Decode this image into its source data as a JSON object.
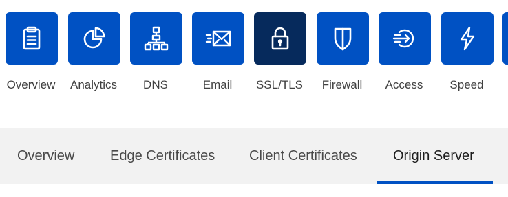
{
  "app_nav": {
    "tiles": [
      {
        "label": "Overview",
        "icon": "clipboard-icon"
      },
      {
        "label": "Analytics",
        "icon": "pie-chart-icon"
      },
      {
        "label": "DNS",
        "icon": "network-tree-icon"
      },
      {
        "label": "Email",
        "icon": "envelope-icon"
      },
      {
        "label": "SSL/TLS",
        "icon": "lock-icon",
        "active": true
      },
      {
        "label": "Firewall",
        "icon": "shield-icon"
      },
      {
        "label": "Access",
        "icon": "access-arrow-icon"
      },
      {
        "label": "Speed",
        "icon": "lightning-icon"
      }
    ]
  },
  "sub_nav": {
    "tabs": [
      {
        "label": "Overview"
      },
      {
        "label": "Edge Certificates"
      },
      {
        "label": "Client Certificates"
      },
      {
        "label": "Origin Server",
        "active": true
      }
    ]
  },
  "colors": {
    "tile_blue": "#0051c3",
    "tile_active": "#062a5c",
    "underline": "#0051c3"
  }
}
